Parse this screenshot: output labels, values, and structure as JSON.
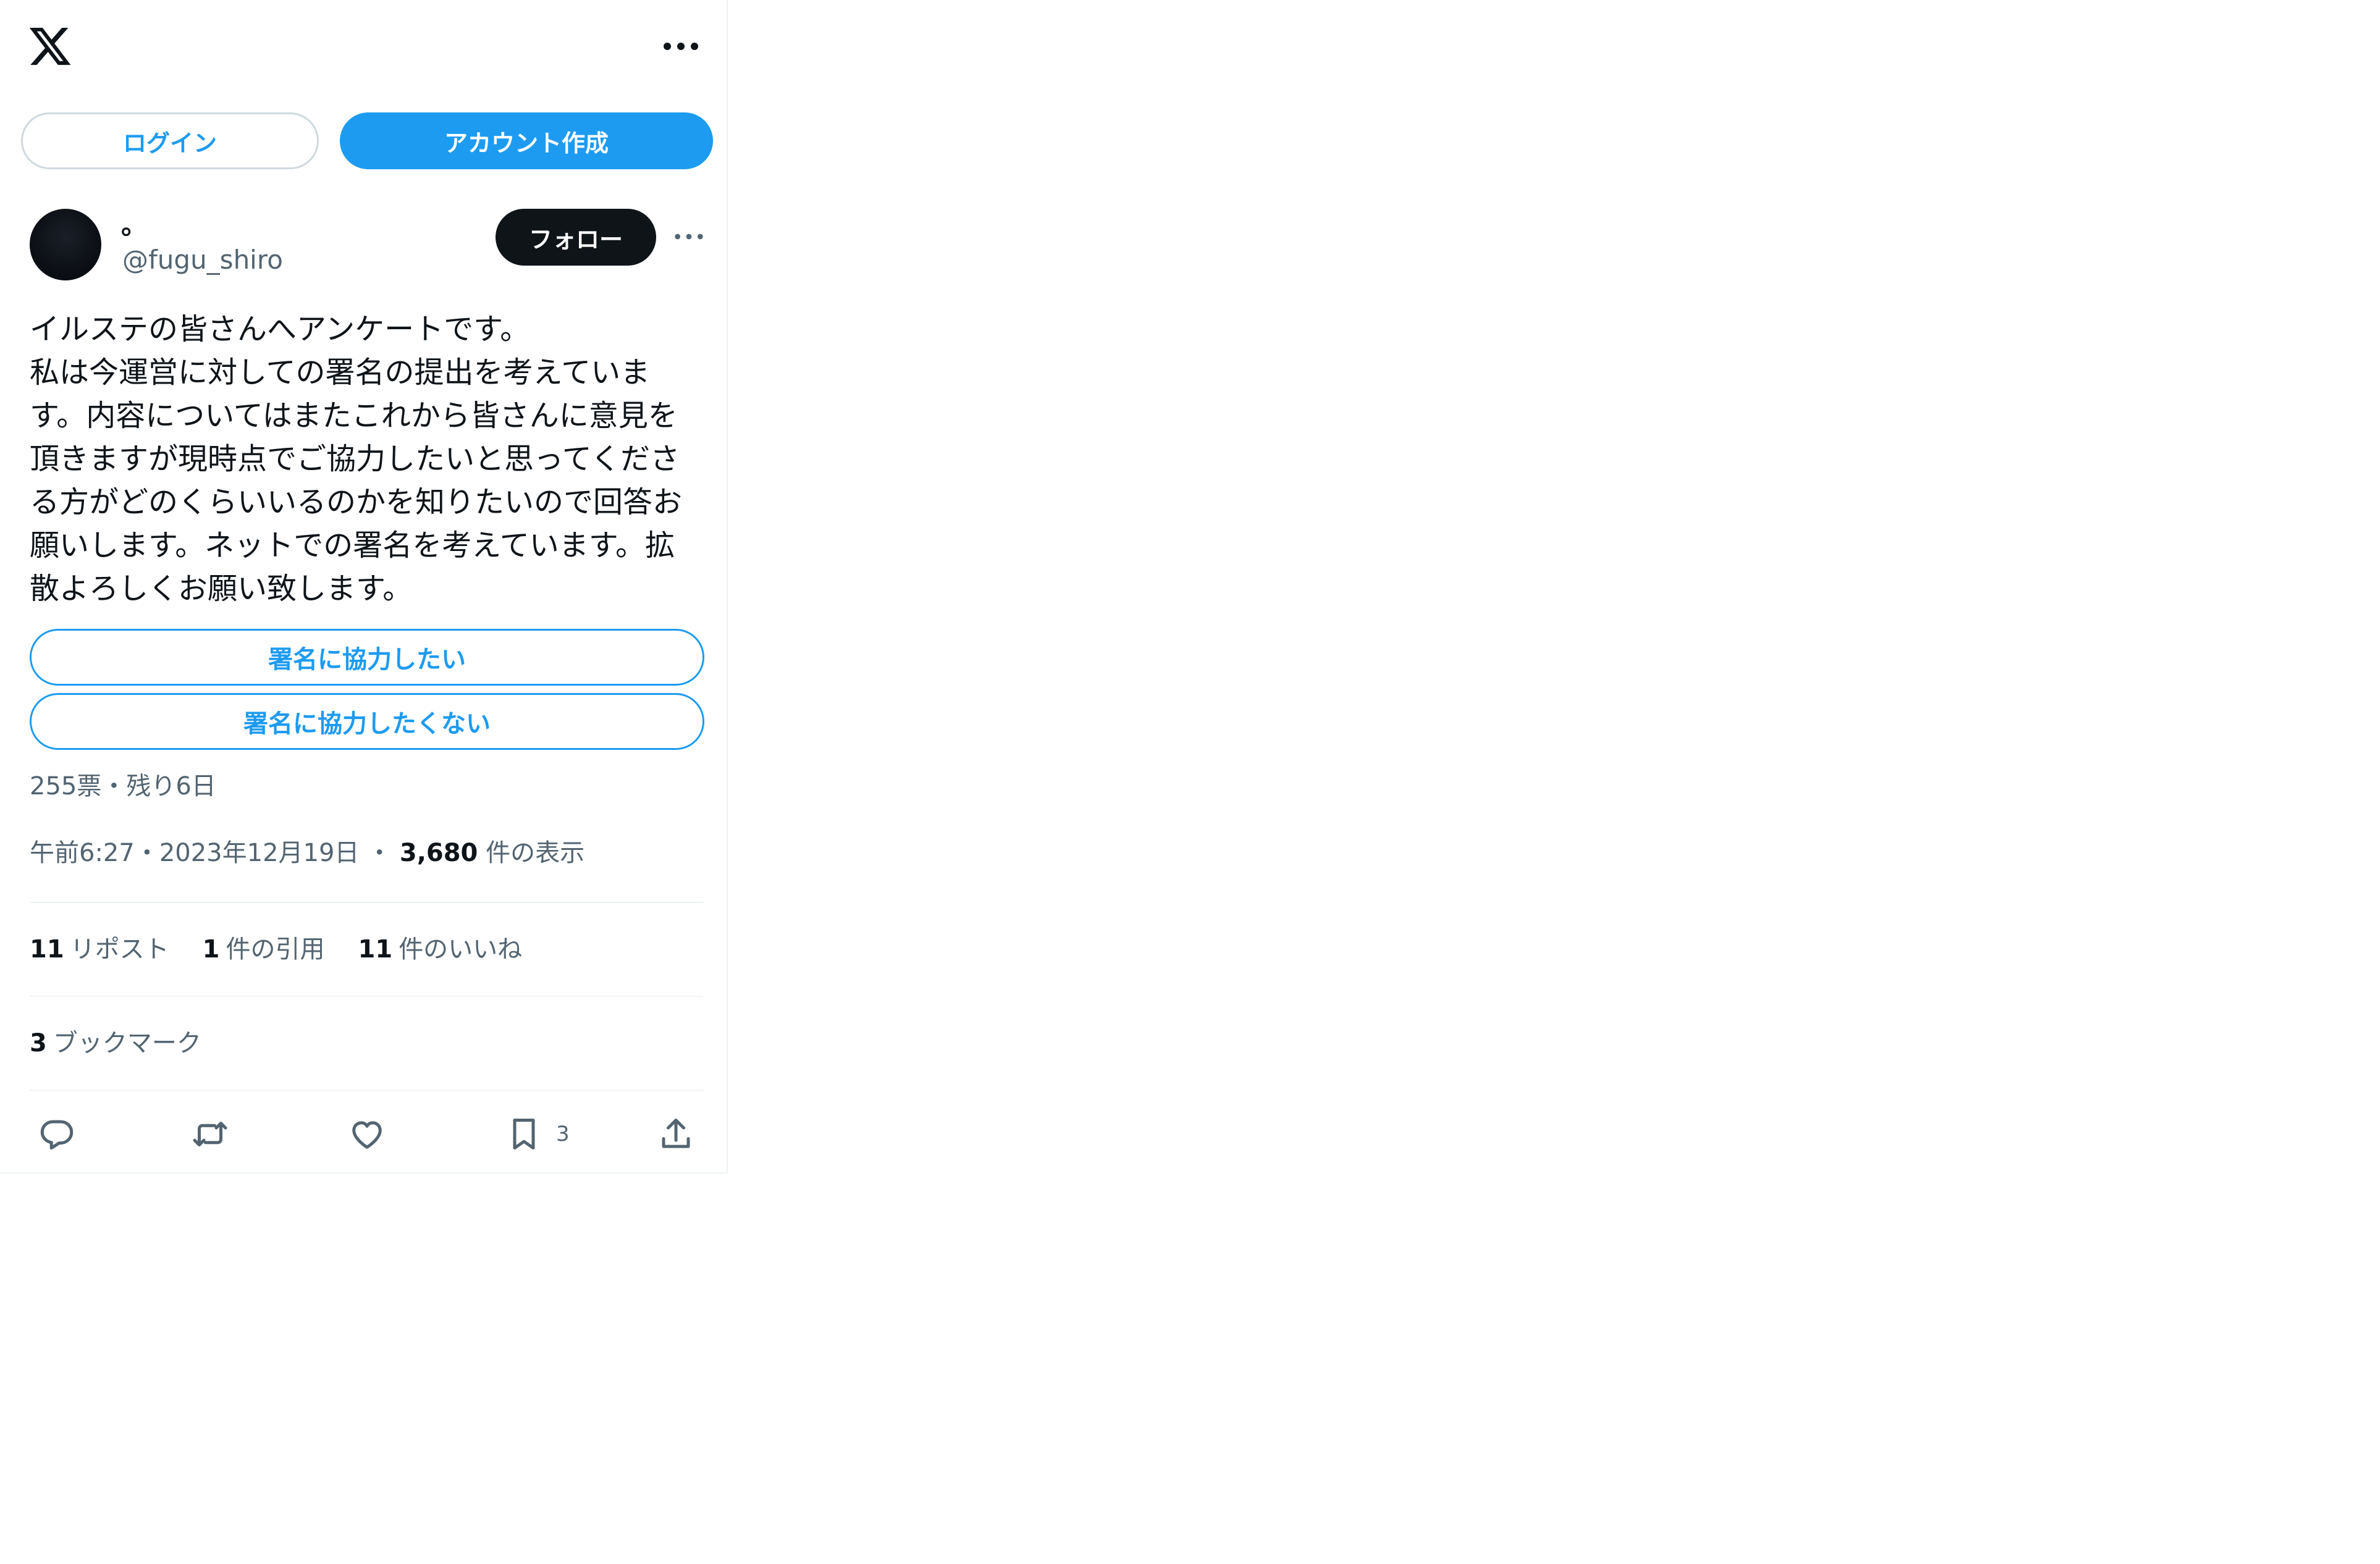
{
  "header": {
    "logo": "x-logo-icon",
    "more": "more-horizontal-icon",
    "login_label": "ログイン",
    "signup_label": "アカウント作成"
  },
  "author": {
    "display_name": "。",
    "handle": "@fugu_shiro",
    "follow_label": "フォロー"
  },
  "tweet": {
    "text": "イルステの皆さんへアンケートです。\n私は今運営に対しての署名の提出を考えていま\nす。内容についてはまたこれから皆さんに意見を\n頂きますが現時点でご協力したいと思ってくださ\nる方がどのくらいいるのかを知りたいので回答お\n願いします。ネットでの署名を考えています。拡\n散よろしくお願い致します。",
    "poll": {
      "options": [
        "署名に協力したい",
        "署名に協力したくない"
      ],
      "summary": "255票・残り6日"
    },
    "time": "午前6:27",
    "date": "2023年12月19日",
    "views_count": "3,680",
    "views_label": "件の表示"
  },
  "stats": {
    "reposts_count": "11",
    "reposts_label": "リポスト",
    "quotes_count": "1",
    "quotes_label": "件の引用",
    "likes_count": "11",
    "likes_label": "件のいいね",
    "bookmarks_count": "3",
    "bookmarks_label": "ブックマーク"
  },
  "actions": {
    "reply": "reply-icon",
    "repost": "repost-icon",
    "like": "heart-icon",
    "bookmark": "bookmark-icon",
    "bookmark_count": "3",
    "share": "share-icon"
  },
  "colors": {
    "accent": "#1d9bf0",
    "text": "#0f1419",
    "secondary": "#536471",
    "border": "#cfd9de"
  }
}
